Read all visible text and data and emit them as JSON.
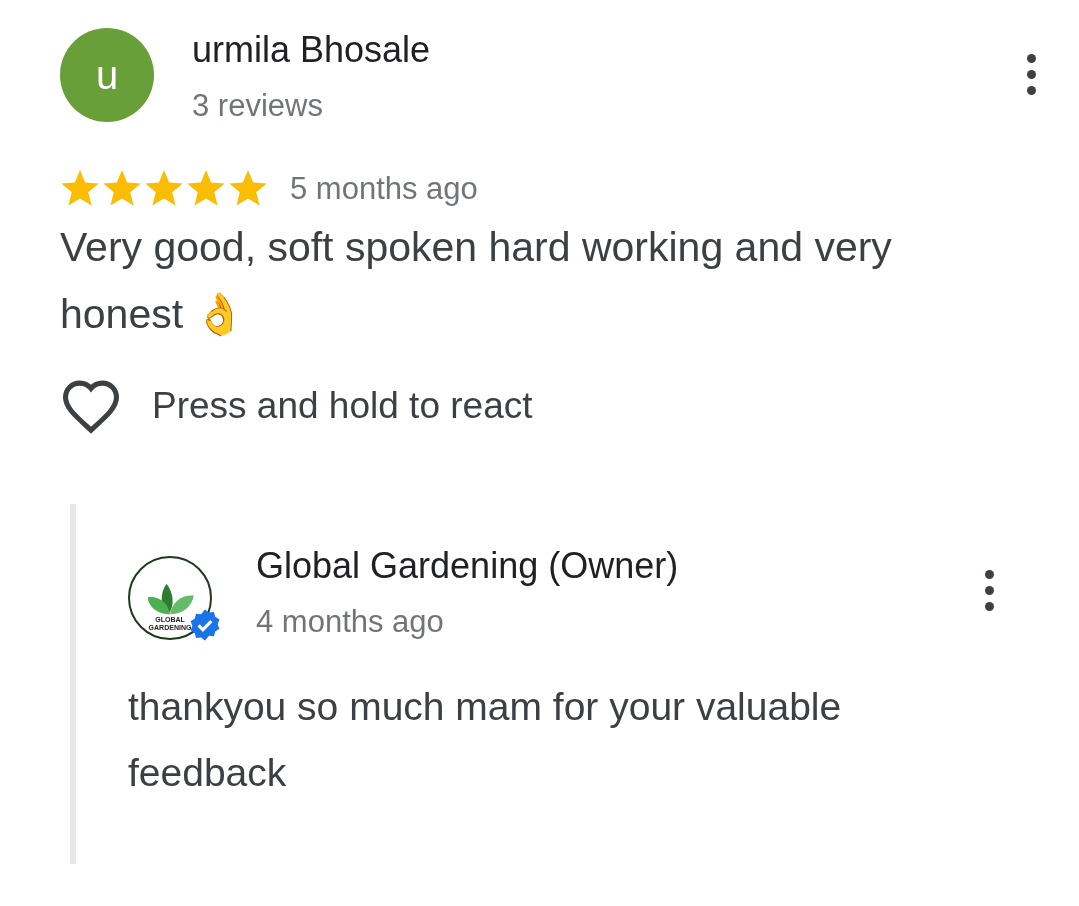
{
  "review": {
    "avatar_letter": "u",
    "author": "urmila Bhosale",
    "meta": "3 reviews",
    "stars": 5,
    "time": "5 months ago",
    "text": "Very good, soft spoken hard working and very honest 👌",
    "react_label": "Press and hold to react"
  },
  "reply": {
    "logo_text": [
      "GLOBAL",
      "GARDENING"
    ],
    "verified": true,
    "author": "Global Gardening (Owner)",
    "time": "4 months ago",
    "text": "thankyou so much mam for your valuable feedback"
  }
}
